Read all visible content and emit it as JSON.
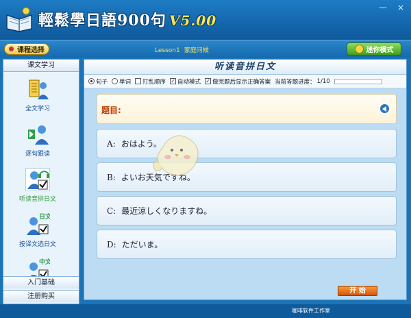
{
  "window": {
    "title": "輕鬆學日語900句",
    "version": "V5.00",
    "buttons": [
      "—",
      "×"
    ]
  },
  "toolbar": {
    "course_button": "课程选择",
    "lesson_id": "Lesson1",
    "lesson_name": "家庭问候",
    "mini_mode_button": "迷你模式"
  },
  "sidebar": {
    "header": "课文学习",
    "items": [
      {
        "label": "全文学习",
        "icon": "book-person-icon"
      },
      {
        "label": "逐句跟读",
        "icon": "person-play-icon"
      },
      {
        "label": "听读音拼日文",
        "icon": "headphone-check-icon",
        "active": true
      },
      {
        "label": "按译文选日文",
        "icon": "person-check-icon",
        "badge": "日文"
      },
      {
        "label": "",
        "icon": "person-check-icon",
        "badge": "中文"
      }
    ],
    "footer_items": [
      "入门基础",
      "注册购买"
    ]
  },
  "main": {
    "title": "听读音拼日文",
    "options": {
      "radio_sentence": "句子",
      "radio_word": "单词",
      "shuffle": "打乱顺序",
      "auto_mode": "自动模式",
      "show_answer": "做完题后显示正确答案",
      "progress_label": "当前答题进度：",
      "progress_value": "1/10"
    },
    "question_label": "题目:",
    "answers": [
      {
        "letter": "A:",
        "text": "おはよう。"
      },
      {
        "letter": "B:",
        "text": "よいお天気ですね。"
      },
      {
        "letter": "C:",
        "text": "最近涼しくなりますね。"
      },
      {
        "letter": "D:",
        "text": "ただいま。"
      }
    ],
    "start_button": "开 始"
  },
  "footer": {
    "studio": "咖啡软件工作室"
  },
  "colors": {
    "title_bg": "#1466ac",
    "accent_yellow": "#ffe84a",
    "start_orange": "#d2550b",
    "mini_green": "#3e9e1d"
  }
}
